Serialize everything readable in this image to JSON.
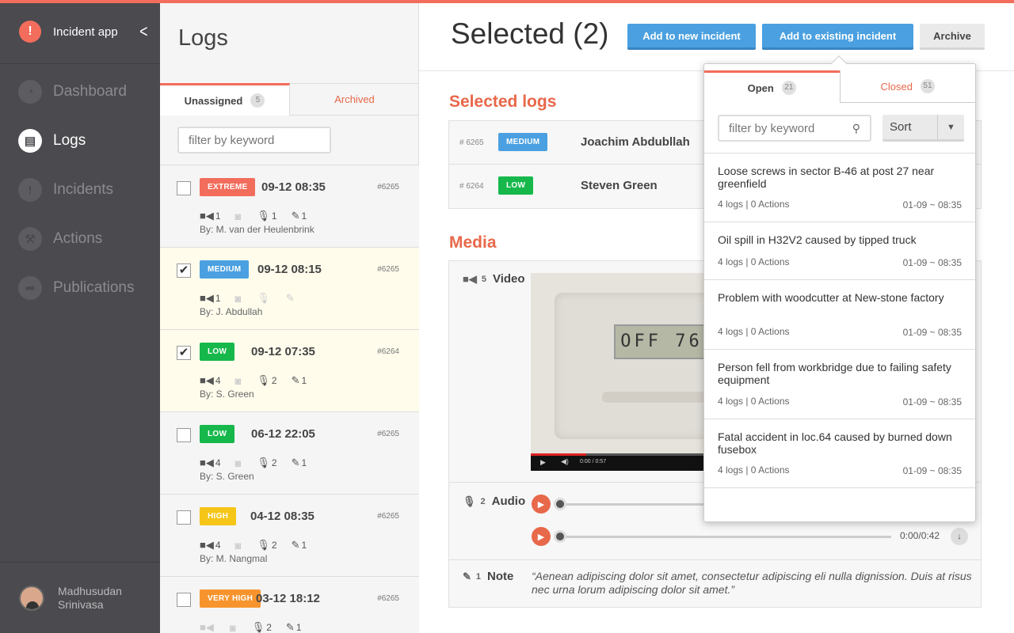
{
  "app": {
    "name": "Incident app"
  },
  "nav": [
    {
      "label": "Dashboard",
      "icon": "dashboard-icon"
    },
    {
      "label": "Logs",
      "icon": "document-icon",
      "active": true
    },
    {
      "label": "Incidents",
      "icon": "exclamation-icon"
    },
    {
      "label": "Actions",
      "icon": "hammer-icon"
    },
    {
      "label": "Publications",
      "icon": "share-icon"
    }
  ],
  "user": {
    "name": "Madhusudan Srinivasa"
  },
  "logs": {
    "title": "Logs",
    "tabs": [
      {
        "label": "Unassigned",
        "count": "5"
      },
      {
        "label": "Archived"
      }
    ],
    "filter_placeholder": "filter by keyword",
    "items": [
      {
        "checked": false,
        "level": "EXTREME",
        "color": "#f26d5b",
        "date": "09-12 08:35",
        "id": "#6265",
        "video": "1",
        "photo": "",
        "audio": "1",
        "note": "1",
        "by": "By: M. van der Heulenbrink"
      },
      {
        "checked": true,
        "level": "MEDIUM",
        "color": "#4aa0e0",
        "date": "09-12 08:15",
        "id": "#6265",
        "video": "1",
        "photo": "",
        "audio": "",
        "note": "",
        "by": "By: J. Abdullah"
      },
      {
        "checked": true,
        "level": "LOW",
        "color": "#16b84b",
        "date": "09-12 07:35",
        "id": "#6264",
        "video": "4",
        "photo": "",
        "audio": "2",
        "note": "1",
        "by": "By: S. Green"
      },
      {
        "checked": false,
        "level": "LOW",
        "color": "#16b84b",
        "date": "06-12 22:05",
        "id": "#6265",
        "video": "4",
        "photo": "",
        "audio": "2",
        "note": "1",
        "by": "By: S. Green"
      },
      {
        "checked": false,
        "level": "HIGH",
        "color": "#f5c518",
        "date": "04-12 08:35",
        "id": "#6265",
        "video": "4",
        "photo": "",
        "audio": "2",
        "note": "1",
        "by": "By: M. Nangmal"
      },
      {
        "checked": false,
        "level": "VERY HIGH",
        "color": "#f7942d",
        "date": "03-12 18:12",
        "id": "#6265",
        "video": "",
        "photo": "",
        "audio": "2",
        "note": "1",
        "by": ""
      }
    ]
  },
  "main": {
    "title": "Selected (2)",
    "buttons": {
      "new": "Add to new incident",
      "existing": "Add to existing incident",
      "archive": "Archive"
    },
    "selected_logs_title": "Selected logs",
    "selected": [
      {
        "id": "# 6265",
        "level": "MEDIUM",
        "color": "#4aa0e0",
        "name": "Joachim Abdubllah"
      },
      {
        "id": "# 6264",
        "level": "LOW",
        "color": "#16b84b",
        "name": "Steven Green"
      }
    ],
    "media_title": "Media",
    "video": {
      "label": "Video",
      "count": "5",
      "time": "0:00 / 0:57",
      "lcd": "OFF  76"
    },
    "audio": {
      "label": "Audio",
      "count": "2",
      "time": "0:00/0:42"
    },
    "note": {
      "label": "Note",
      "count": "1",
      "text": "“Aenean adipiscing dolor sit amet, consectetur adipiscing eli nulla dignission. Duis at risus nec urna lorum adipiscing dolor sit amet.”"
    }
  },
  "popup": {
    "tabs": [
      {
        "label": "Open",
        "count": "21"
      },
      {
        "label": "Closed",
        "count": "51"
      }
    ],
    "filter_placeholder": "filter by keyword",
    "sort_label": "Sort",
    "items": [
      {
        "title": "Loose screws in sector B-46 at post 27 near greenfield",
        "stats": "4 logs | 0 Actions",
        "date": "01-09 ~ 08:35"
      },
      {
        "title": "Oil spill in H32V2 caused by tipped truck",
        "stats": "4 logs | 0 Actions",
        "date": "01-09 ~ 08:35"
      },
      {
        "title": "Problem with woodcutter at New-stone factory",
        "stats": "4 logs | 0 Actions",
        "date": "01-09 ~ 08:35"
      },
      {
        "title": "Person fell from workbridge due to failing safety equipment",
        "stats": "4 logs | 0 Actions",
        "date": "01-09 ~ 08:35"
      },
      {
        "title": "Fatal accident in loc.64 caused by burned down fusebox",
        "stats": "4 logs | 0 Actions",
        "date": "01-09 ~ 08:35"
      }
    ]
  }
}
